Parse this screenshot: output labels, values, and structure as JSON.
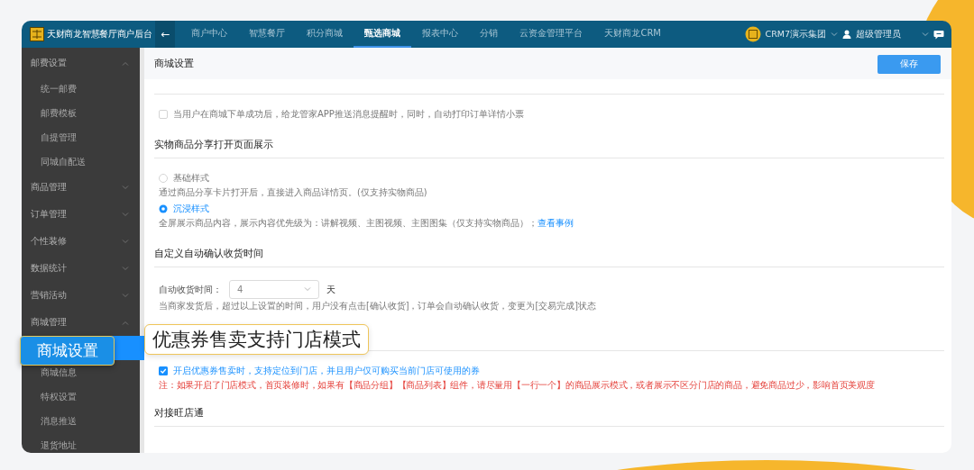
{
  "top_bar": {
    "title": "天财商龙智慧餐厅商户后台",
    "back": "←",
    "nav": [
      {
        "label": "商户中心",
        "selected": false
      },
      {
        "label": "智慧餐厅",
        "selected": false
      },
      {
        "label": "积分商城",
        "selected": false
      },
      {
        "label": "甄选商城",
        "selected": true
      },
      {
        "label": "报表中心",
        "selected": false
      },
      {
        "label": "分销",
        "selected": false
      },
      {
        "label": "云资金管理平台",
        "selected": false
      },
      {
        "label": "天财商龙CRM",
        "selected": false
      }
    ],
    "organization": "CRM7演示集团",
    "user": "超级管理员"
  },
  "sidebar": {
    "groups": [
      {
        "label": "邮费设置",
        "expanded": true,
        "children": [
          {
            "label": "统一邮费",
            "selected": false
          },
          {
            "label": "邮费模板",
            "selected": false
          },
          {
            "label": "自提管理",
            "selected": false
          },
          {
            "label": "同城自配送",
            "selected": false
          }
        ]
      },
      {
        "label": "商品管理",
        "expanded": false
      },
      {
        "label": "订单管理",
        "expanded": false
      },
      {
        "label": "个性装修",
        "expanded": false
      },
      {
        "label": "数据统计",
        "expanded": false
      },
      {
        "label": "营销活动",
        "expanded": false
      },
      {
        "label": "商城管理",
        "expanded": true,
        "children": [
          {
            "label": "商城设置",
            "selected": true
          },
          {
            "label": "商城信息",
            "selected": false
          },
          {
            "label": "特权设置",
            "selected": false
          },
          {
            "label": "消息推送",
            "selected": false
          },
          {
            "label": "退货地址",
            "selected": false
          }
        ]
      }
    ]
  },
  "page": {
    "title": "商城设置",
    "save_button": "保存",
    "sections": [
      {
        "items": [
          {
            "kind": "checkbox",
            "checked": false,
            "label": "当用户在商城下单成功后，给龙管家APP推送消息提醒时，同时，自动打印订单详情小票"
          }
        ]
      },
      {
        "title": "实物商品分享打开页面展示",
        "highlighted": false,
        "items": [
          {
            "kind": "radio",
            "selected": false,
            "label": "基础样式"
          },
          {
            "kind": "note",
            "text": "通过商品分享卡片打开后，直接进入商品详情页。(仅支持实物商品)"
          },
          {
            "kind": "radio",
            "selected": true,
            "label": "沉浸样式"
          },
          {
            "kind": "note",
            "text": "全屏展示商品内容，展示内容优先级为：讲解视频、主图视频、主图图集（仅支持实物商品）；",
            "link": "查看事例"
          }
        ]
      },
      {
        "title": "自定义自动确认收货时间",
        "highlighted": false,
        "items": [
          {
            "kind": "select",
            "label": "自动收货时间：",
            "value": "4",
            "unit": "天"
          },
          {
            "kind": "note",
            "text": "当商家发货后，超过以上设置的时间，用户没有点击[确认收货]，订单会自动确认收货，变更为[交易完成]状态"
          }
        ]
      },
      {
        "title": "优惠券售卖支持门店模式",
        "highlighted": true,
        "items": [
          {
            "kind": "checkbox",
            "checked": true,
            "label": "开启优惠券售卖时，支持定位到门店，并且用户仅可购买当前门店可使用的券"
          },
          {
            "kind": "warning",
            "text": "注：如果开启了门店模式，首页装修时，如果有【商品分组】【商品列表】组件，请尽量用【一行一个】的商品展示模式，或者展示不区分门店的商品，避免商品过少，影响首页美观度"
          }
        ]
      },
      {
        "title": "对接旺店通",
        "highlighted": false
      }
    ]
  }
}
